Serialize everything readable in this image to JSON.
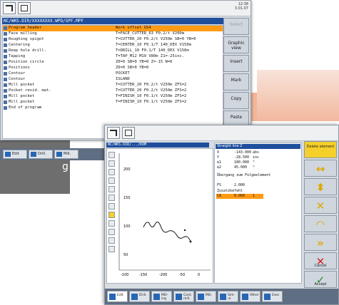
{
  "overlay_text": "g",
  "back_window": {
    "clock": "12:38\n3.01.07",
    "path": "NC/WKS.DIR/XXXXXXXX.WPD/SPF.MPF",
    "rows": [
      {
        "name": "Program header",
        "value": "Work offset G54"
      },
      {
        "name": "Face milling",
        "value": "T=FACE_CUTTER_63 F0.2/t V200m"
      },
      {
        "name": "Roughing spigot",
        "value": "T=CUTTER_20 F0.2/t V250m SB=0 YB=0"
      },
      {
        "name": "Centering",
        "value": "T=CENTER_10 F0.1/T 140_DEX V150m"
      },
      {
        "name": "Deep hole drill.",
        "value": "T=DRILL_10 F0.1/T 140_DEX V150m"
      },
      {
        "name": "Tapping",
        "value": "T=TAP_M12 M10 V80m Z1=-25inc."
      },
      {
        "name": "Position circle",
        "value": "Z0=0 SB=0 YB=0 Z=-15 N=6"
      },
      {
        "name": "Positions",
        "value": "Z0=0 SB=0 YB=0"
      },
      {
        "name": "Contour",
        "value": "POCKET"
      },
      {
        "name": "Contour",
        "value": "ISLAND"
      },
      {
        "name": "Mill pocket",
        "value": "T=CUTTER_20 F0.2/t V250m ZFS=2"
      },
      {
        "name": "Pocket resid. mat.",
        "value": "T=CUTTER_20 F0.2/t V250m ZFS=2"
      },
      {
        "name": "Mill pocket",
        "value": "T=FINISH_10 F0.1/t V250m ZFS=2"
      },
      {
        "name": "Mill pocket",
        "value": "T=FINISH_10 F0.1/t V250m ZFS=2"
      },
      {
        "name": "End of program",
        "value": ""
      }
    ],
    "softkeys": [
      "Select",
      "Graphic view",
      "Insert",
      "Mark",
      "Copy",
      "Paste"
    ],
    "bottom_keys": [
      "Edit",
      "Drill.",
      "Mill."
    ]
  },
  "front_window": {
    "path": "NC/WKS.DIR/.../KOM",
    "params_title": "Straight line Z",
    "params": [
      {
        "label": "X",
        "value": "-143.000",
        "unit": "abs"
      },
      {
        "label": "Y",
        "value": "-28.500",
        "unit": "inc"
      },
      {
        "label": "α1",
        "value": "180.000",
        "unit": "°"
      },
      {
        "label": "α2",
        "value": "45.000",
        "unit": "°"
      },
      {
        "label": "Übergang zum Folgeelement",
        "value": "",
        "unit": ""
      },
      {
        "label": "",
        "value": "Chamfer",
        "unit": ""
      },
      {
        "label": "FS",
        "value": "2.000",
        "unit": ""
      },
      {
        "label": "Zusatzbefehl",
        "value": "",
        "unit": ""
      },
      {
        "label": "CA",
        "value": "0.060",
        "unit": "1"
      }
    ],
    "axis_labels": [
      "-100",
      "-150",
      "-200",
      "-50",
      "0"
    ],
    "y_labels": [
      "200",
      "150",
      "100",
      "50"
    ],
    "softkeys": [
      "Delete element",
      "",
      "",
      "",
      "",
      "",
      "",
      "Cancel",
      "Accept"
    ],
    "bottom_keys": [
      "Edit",
      "Drill.",
      "Mill- ing",
      "Cont. mill.",
      "Mill.",
      "Sim- ul.",
      "Other",
      "Exec"
    ]
  }
}
